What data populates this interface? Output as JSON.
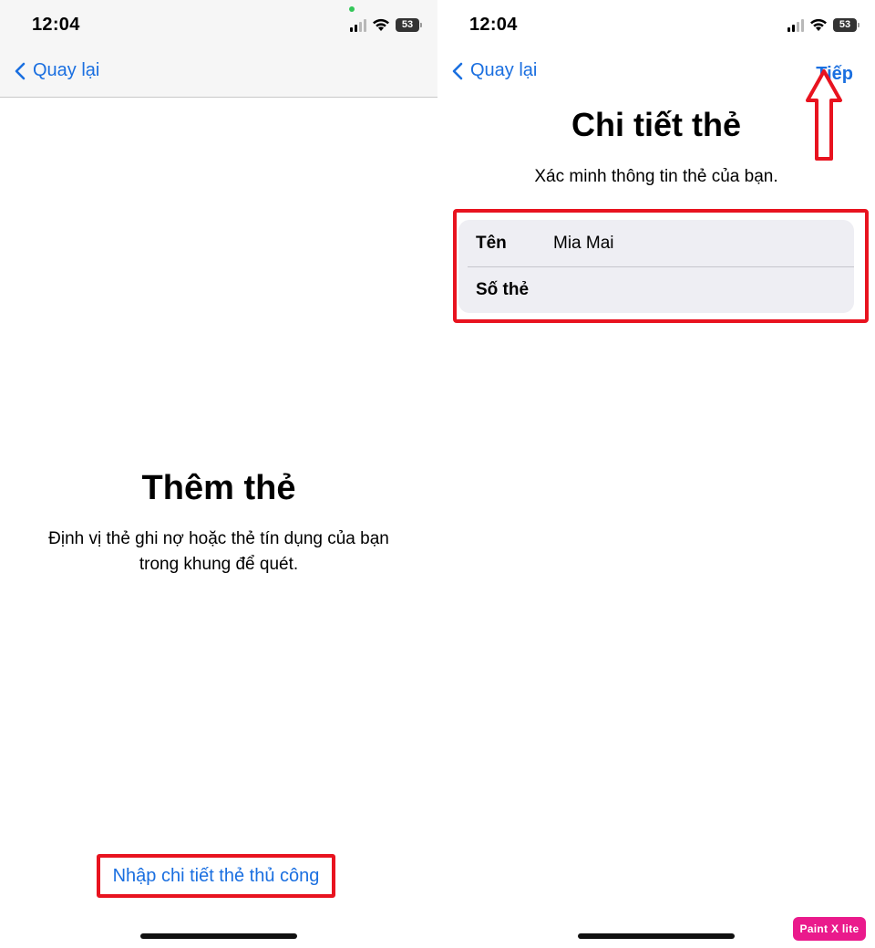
{
  "colors": {
    "link_blue": "#1a6fe0",
    "highlight_red": "#e8131f",
    "card_gray": "#eeeef3",
    "navbar_gray": "#f6f6f6",
    "logo_pink": "#ea1a8c"
  },
  "left_screen": {
    "status_bar": {
      "time": "12:04",
      "battery_level": "53",
      "icons": [
        "signal-icon",
        "wifi-icon",
        "battery-icon",
        "camera-indicator-dot"
      ]
    },
    "nav": {
      "back_label": "Quay lại",
      "back_icon": "chevron-left-icon"
    },
    "title": "Thêm thẻ",
    "subtitle_line1": "Định vị thẻ ghi nợ hoặc thẻ tín dụng của bạn",
    "subtitle_line2": "trong khung để quét.",
    "manual_entry_link": "Nhập chi tiết thẻ thủ công"
  },
  "right_screen": {
    "status_bar": {
      "time": "12:04",
      "battery_level": "53",
      "icons": [
        "signal-icon",
        "wifi-icon",
        "battery-icon"
      ]
    },
    "nav": {
      "back_label": "Quay lại",
      "back_icon": "chevron-left-icon",
      "next_label": "Tiếp"
    },
    "title": "Chi tiết thẻ",
    "subtitle": "Xác minh thông tin thẻ của bạn.",
    "form": {
      "rows": [
        {
          "label": "Tên",
          "value": "Mia Mai"
        },
        {
          "label": "Số thẻ",
          "value": ""
        }
      ]
    },
    "annotation": {
      "icon": "up-arrow-icon"
    }
  },
  "watermark": {
    "text": "Paint X lite"
  }
}
